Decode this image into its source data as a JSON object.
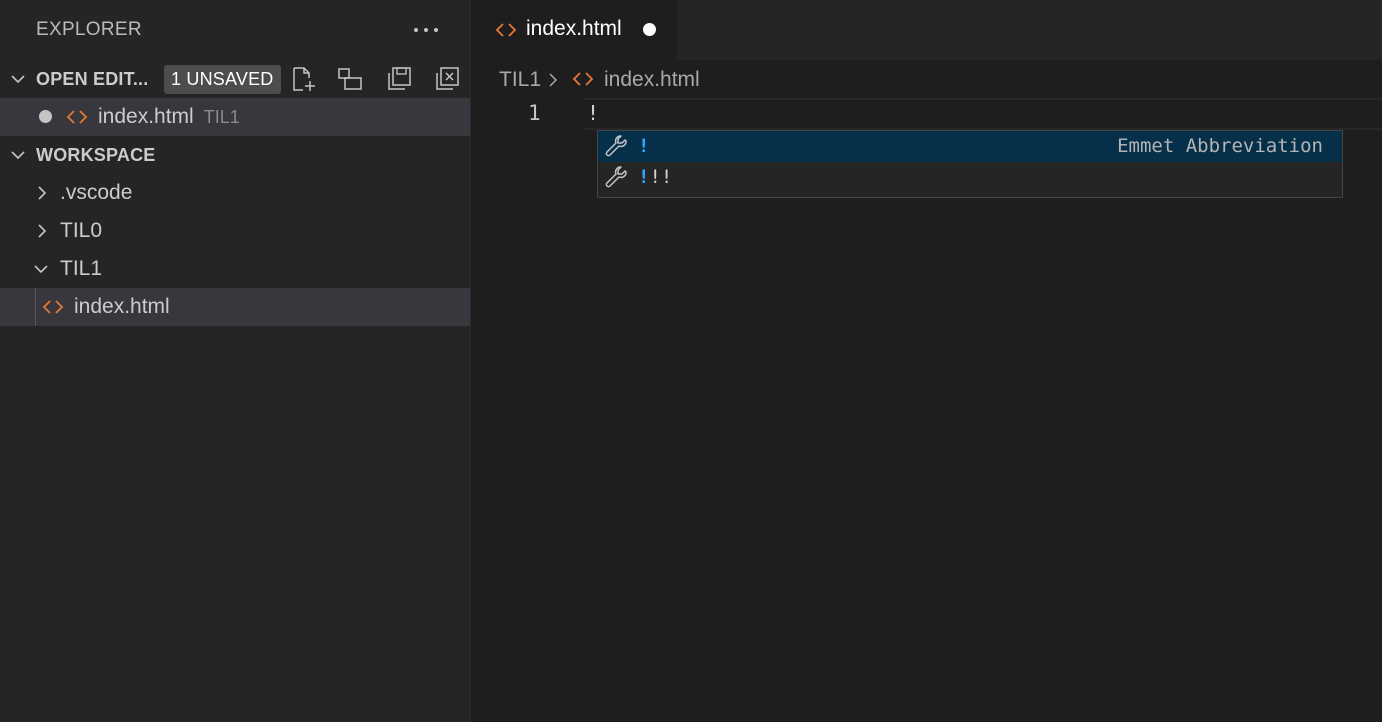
{
  "sidebar": {
    "title": "EXPLORER",
    "open_editors": {
      "title": "OPEN EDIT...",
      "badge": "1 UNSAVED",
      "items": [
        {
          "label": "index.html",
          "description": "TIL1"
        }
      ]
    },
    "workspace": {
      "title": "WORKSPACE",
      "items": [
        {
          "label": ".vscode"
        },
        {
          "label": "TIL0"
        },
        {
          "label": "TIL1"
        },
        {
          "label": "index.html"
        }
      ]
    }
  },
  "editor": {
    "tab": {
      "label": "index.html"
    },
    "breadcrumb": [
      "TIL1",
      "index.html"
    ],
    "lines": [
      {
        "number": "1",
        "text": "!"
      }
    ],
    "suggestions": [
      {
        "highlight": "!",
        "rest": "",
        "detail": "Emmet Abbreviation"
      },
      {
        "highlight": "!",
        "rest": "!!",
        "detail": ""
      }
    ]
  },
  "colors": {
    "html_icon": "#e37933",
    "match_highlight": "#2aaaff",
    "focused_suggestion": "#062f4a",
    "selected_row": "#37373d"
  },
  "icons": [
    "more-icon",
    "new-file-icon",
    "new-folder-icon",
    "save-all-icon",
    "close-all-icon",
    "html-file-icon",
    "wrench-icon",
    "chevron-down-icon",
    "chevron-right-icon"
  ]
}
